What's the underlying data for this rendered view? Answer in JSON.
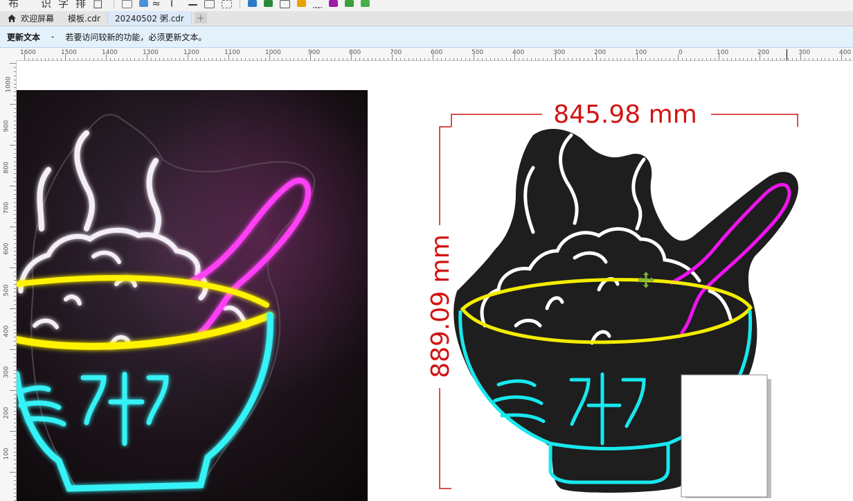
{
  "toolbar": {
    "glyphs": [
      "布",
      "识",
      "字",
      "排"
    ],
    "icon_names": [
      "page-icon",
      "view-icon",
      "wave-icon",
      "align-icon",
      "line-icon",
      "connector-icon",
      "select-icon",
      "shape-icon",
      "green-fill-icon",
      "text-tool-icon",
      "grid-icon",
      "dots-icon",
      "effects-icon",
      "brush-icon",
      "export-icon"
    ]
  },
  "tabs": [
    {
      "label": "欢迎屏幕"
    },
    {
      "label": "模板.cdr"
    },
    {
      "label": "20240502 粥.cdr"
    }
  ],
  "notice": {
    "title": "更新文本",
    "dash": "-",
    "message": "若要访问较新的功能，必须更新文本。"
  },
  "ruler": {
    "h_labels": [
      "1600",
      "1500",
      "1400",
      "1300",
      "1200",
      "1100",
      "1000",
      "900",
      "800",
      "700",
      "600",
      "500",
      "400",
      "300",
      "200",
      "100",
      "0",
      "100",
      "200",
      "300",
      "400"
    ],
    "v_labels": [
      "1000",
      "900",
      "800",
      "700",
      "600",
      "500",
      "400",
      "300",
      "200",
      "100"
    ]
  },
  "dimensions": {
    "width": "845.98 mm",
    "height": "889.09 mm"
  },
  "artwork": {
    "character": "粥"
  },
  "colors": {
    "dimension_red": "#d11414",
    "neon_yellow": "#f3ec00",
    "neon_cyan": "#17e8ee",
    "neon_magenta": "#ee14ee",
    "backing_black": "#1e1e1e",
    "move_cursor_green": "#7ab53a"
  }
}
